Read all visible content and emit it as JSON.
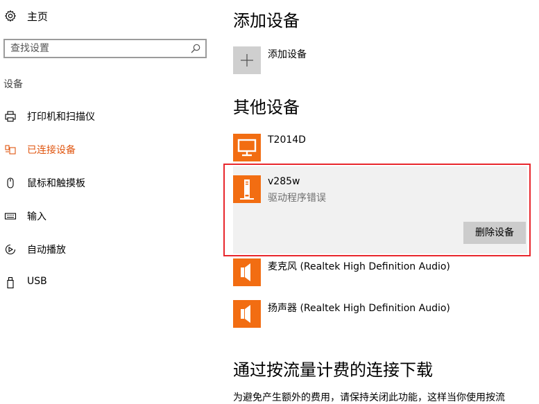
{
  "sidebar": {
    "home_label": "主页",
    "search_placeholder": "查找设置",
    "section_label": "设备",
    "items": [
      {
        "label": "打印机和扫描仪",
        "icon": "printer-icon",
        "active": false
      },
      {
        "label": "已连接设备",
        "icon": "connected-devices-icon",
        "active": true
      },
      {
        "label": "鼠标和触摸板",
        "icon": "mouse-icon",
        "active": false
      },
      {
        "label": "输入",
        "icon": "keyboard-icon",
        "active": false
      },
      {
        "label": "自动播放",
        "icon": "autoplay-icon",
        "active": false
      },
      {
        "label": "USB",
        "icon": "usb-icon",
        "active": false
      }
    ]
  },
  "main": {
    "add_section_title": "添加设备",
    "add_device_label": "添加设备",
    "other_section_title": "其他设备",
    "devices": [
      {
        "name": "T2014D",
        "status": "",
        "icon": "monitor-icon"
      },
      {
        "name": "v285w",
        "status": "驱动程序错误",
        "icon": "usb-drive-icon",
        "selected": true
      },
      {
        "name": "麦克风 (Realtek High Definition Audio)",
        "status": "",
        "icon": "speaker-icon"
      },
      {
        "name": "扬声器 (Realtek High Definition Audio)",
        "status": "",
        "icon": "speaker-icon"
      }
    ],
    "remove_button_label": "删除设备",
    "metered_section_title": "通过按流量计费的连接下载",
    "metered_description": "为避免产生额外的费用，请保持关闭此功能，这样当你使用按流"
  },
  "colors": {
    "accent": "#e0550f",
    "device_tile": "#f26d12",
    "selection_border": "#e8262c",
    "selected_background": "#f1f1f1",
    "button_background": "#cccccc"
  }
}
